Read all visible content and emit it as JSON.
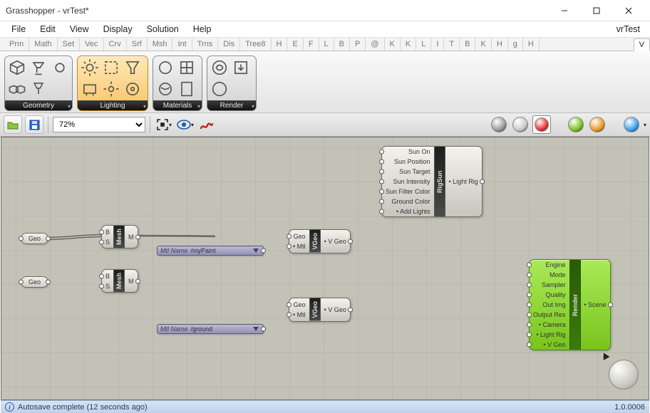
{
  "window": {
    "title": "Grasshopper - vrTest*"
  },
  "menubar": {
    "items": [
      "File",
      "Edit",
      "View",
      "Display",
      "Solution",
      "Help"
    ],
    "doc": "vrTest"
  },
  "tabs": {
    "items": [
      "Prm",
      "Math",
      "Set",
      "Vec",
      "Crv",
      "Srf",
      "Msh",
      "Int",
      "Trns",
      "Dis",
      "Tree8",
      "H",
      "E",
      "F",
      "L",
      "B",
      "P",
      "@",
      "K",
      "K",
      "L",
      "I",
      "T",
      "B",
      "K",
      "H",
      "g",
      "H"
    ],
    "active": "V"
  },
  "panels": {
    "geometry": {
      "label": "Geometry"
    },
    "lighting": {
      "label": "Lighting"
    },
    "materials": {
      "label": "Materials"
    },
    "render": {
      "label": "Render"
    }
  },
  "toolbar2": {
    "zoom": "72%"
  },
  "status": {
    "msg": "Autosave complete (12 seconds ago)",
    "version": "1.0.0006"
  },
  "nodes": {
    "geo1": {
      "label": "Geo"
    },
    "geo2": {
      "label": "Geo"
    },
    "mesh": {
      "name": "Mesh",
      "in": [
        "B",
        "S"
      ],
      "out": [
        "M"
      ]
    },
    "panel1": {
      "label": "Mtl Name",
      "value": "/myPaint"
    },
    "panel2": {
      "label": "Mtl Name",
      "value": "/ground"
    },
    "vgeo": {
      "name": "VGeo",
      "in": [
        "Geo",
        "• Mtl"
      ],
      "out": [
        "• V Geo"
      ]
    },
    "rigsun": {
      "name": "RigSun",
      "in": [
        "Sun On",
        "Sun Position",
        "Sun Target",
        "Sun Intensity",
        "Sun Filter Color",
        "Ground Color",
        "• Add Lights"
      ],
      "out": [
        "• Light Rig"
      ]
    },
    "render": {
      "name": "Render",
      "in": [
        "Engine",
        "Mode",
        "Sampler",
        "Quality",
        "Out Img",
        "Output Res",
        "• Camera",
        "• Light Rig",
        "• V Geo"
      ],
      "out": [
        "• Scene"
      ]
    }
  }
}
